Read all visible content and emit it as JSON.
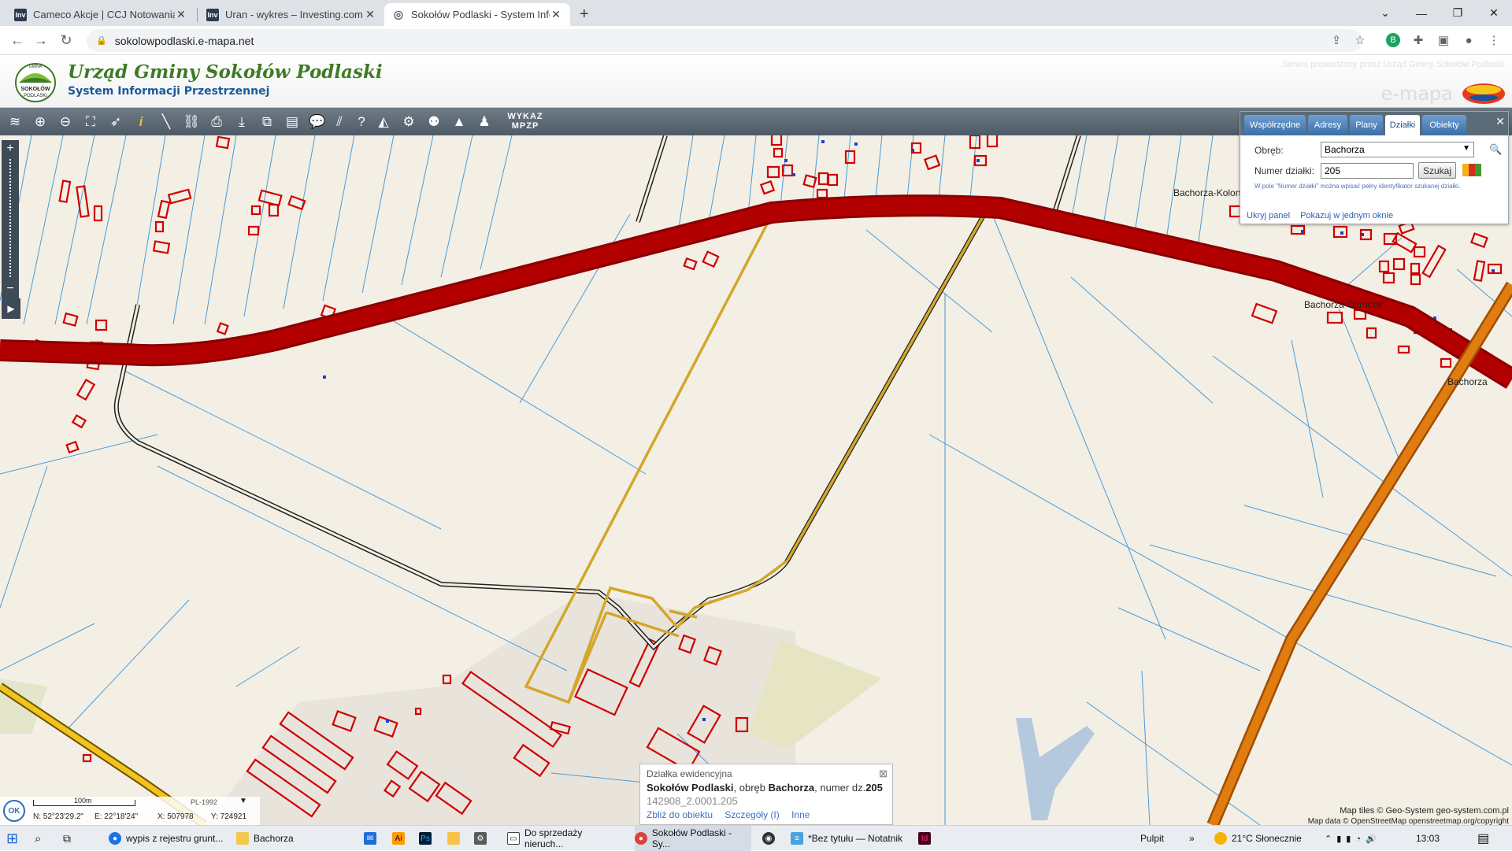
{
  "browser": {
    "tabs": [
      {
        "title": "Cameco Akcje | CCJ Notowania -",
        "favicon": "Inv"
      },
      {
        "title": "Uran - wykres – Investing.com",
        "favicon": "Inv"
      },
      {
        "title": "Sokołów Podlaski - System Inform",
        "favicon": "globe-icon"
      }
    ],
    "url": "sokolowpodlaski.e-mapa.net",
    "new_tab_symbol": "+"
  },
  "header": {
    "title": "Urząd Gminy Sokołów Podlaski",
    "subtitle": "System Informacji Przestrzennej",
    "service_note": "Serwis prowadzony przez Urząd Gminy Sokołów Podlaski",
    "brand": "e-mapa",
    "logo_text_top": "GMINA",
    "logo_text_mid": "SOKOŁÓW",
    "logo_text_bot": "PODLASKI"
  },
  "toolbar": {
    "wykaz_line1": "WYKAZ",
    "wykaz_line2": "MPZP"
  },
  "search_panel": {
    "tabs": [
      "Współrzędne",
      "Adresy",
      "Plany",
      "Działki",
      "Obiekty"
    ],
    "active_tab": "Działki",
    "obreb_label": "Obręb:",
    "obreb_value": "Bachorza",
    "numer_label": "Numer działki:",
    "numer_value": "205",
    "search_button": "Szukaj",
    "hint": "W pole \"Numer działki\" można wpisać pełny identyfikator szukanej działki.",
    "hide_link": "Ukryj panel",
    "single_window_link": "Pokazuj w jednym oknie"
  },
  "map": {
    "labels": {
      "bachorza_kolonia": "Bachorza-Kolonia",
      "bachorza_osrodek": "Bachorza-Ośrodek",
      "bachorza": "Bachorza"
    },
    "attribution_tiles": "Map tiles © Geo-System geo-system.com.pl",
    "attribution_data": "Map data © OpenStreetMap openstreetmap.org/copyright"
  },
  "popup": {
    "title": "Działka ewidencyjna",
    "place": "Sokołów Podlaski",
    "mid_text": ", obręb ",
    "obreb": "Bachorza",
    "num_text": ", numer dz.",
    "number": "205",
    "id": "142908_2.0001.205",
    "link_zoom": "Zbliż do obiektu",
    "link_details": "Szczegóły (I)",
    "link_other": "Inne"
  },
  "status": {
    "ok": "OK",
    "scale_label": "100m",
    "crs": "PL-1992",
    "lat": "N: 52°23'29.2\"",
    "lon": "E: 22°18'24\"",
    "x": "X: 507978",
    "y": "Y: 724921"
  },
  "taskbar": {
    "items": [
      "wypis z rejestru grunt...",
      "Bachorza",
      "Do sprzedaży nieruch...",
      "Sokołów Podlaski - Sy...",
      "*Bez tytułu — Notatnik"
    ],
    "pulpit": "Pulpit",
    "weather": "21°C  Słonecznie",
    "time": "13:03"
  },
  "colors": {
    "road_main": "#a80000",
    "road_regional": "#e07c10",
    "parcel_line": "#4a9ad8",
    "building": "#d00000",
    "selected_parcel": "#d4a62a",
    "map_bg": "#f3efe5"
  }
}
